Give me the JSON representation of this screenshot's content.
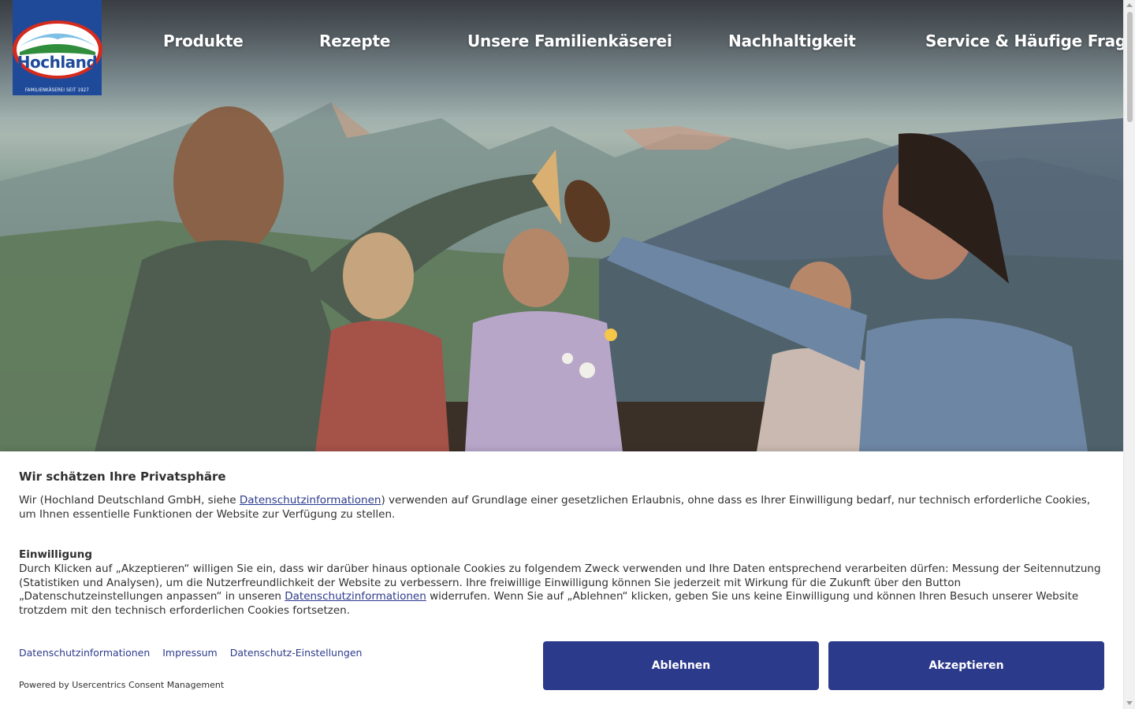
{
  "brand": {
    "logo_text": "Hochland",
    "logo_tagline": "FAMILIENKÄSEREI SEIT 1927"
  },
  "nav": {
    "items": [
      {
        "label": "Produkte"
      },
      {
        "label": "Rezepte"
      },
      {
        "label": "Unsere Familienkäserei"
      },
      {
        "label": "Nachhaltigkeit"
      },
      {
        "label": "Service & Häufige Fragen"
      }
    ]
  },
  "consent": {
    "title": "Wir schätzen Ihre Privatsphäre",
    "intro_before_link": "Wir (Hochland Deutschland GmbH, siehe ",
    "intro_link": "Datenschutzinformationen",
    "intro_after_link": ") verwenden auf Grundlage einer gesetzlichen Erlaubnis, ohne dass es Ihrer Einwilligung bedarf, nur technisch erforderliche Cookies, um Ihnen essentielle Funktionen der Website zur Verfügung zu stellen.",
    "consent_heading": "Einwilligung",
    "consent_before_link": "Durch Klicken auf „Akzeptieren“ willigen Sie ein, dass wir darüber hinaus optionale Cookies zu folgendem Zweck verwenden und Ihre Daten entsprechend verarbeiten dürfen: Messung der Seitennutzung (Statistiken und Analysen), um die Nutzerfreundlichkeit der Website zu verbessern. Ihre freiwillige Einwilligung können Sie jederzeit mit Wirkung für die Zukunft über den Button „Datenschutzeinstellungen anpassen“ in unseren ",
    "consent_link": "Datenschutzinformationen",
    "consent_after_link": " widerrufen. Wenn Sie auf „Ablehnen“ klicken, geben Sie uns keine Einwilligung und können Ihren Besuch unserer Website trotzdem mit den technisch erforderlichen Cookies fortsetzen.",
    "footer_links": [
      "Datenschutzinformationen",
      "Impressum",
      "Datenschutz-Einstellungen"
    ],
    "powered_by": "Powered by Usercentrics Consent Management",
    "deny_label": "Ablehnen",
    "accept_label": "Akzeptieren"
  },
  "colors": {
    "brand_blue": "#1f4a9a",
    "button_blue": "#2c3a8c",
    "logo_red": "#d52b1e"
  }
}
